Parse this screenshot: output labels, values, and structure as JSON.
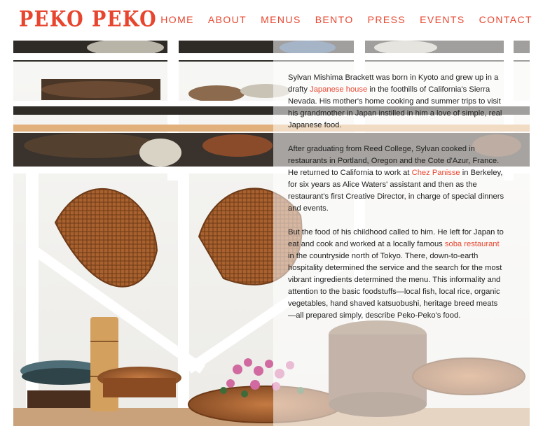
{
  "site": {
    "logo": "PEKO PEKO",
    "nav": [
      "HOME",
      "ABOUT",
      "MENUS",
      "BENTO",
      "PRESS",
      "EVENTS",
      "CONTACT"
    ]
  },
  "colors": {
    "accent": "#e8452e"
  },
  "about": {
    "p1": {
      "a": "Sylvan Mishima Brackett was born in Kyoto and grew up in a drafty ",
      "link": "Japanese house",
      "b": " in the foothills of California's Sierra Nevada. His mother's home cooking and summer trips to visit his grandmother in Japan instilled in him a love of simple, real Japanese food."
    },
    "p2": {
      "a": "After graduating from Reed College, Sylvan cooked in restaurants in Portland, Oregon and the Cote d'Azur, France. He returned to California to work at ",
      "link": "Chez Panisse",
      "b": " in Berkeley, for six years as Alice Waters' assistant and then as the restaurant's first Creative Director, in charge of special dinners and events."
    },
    "p3": {
      "a": "But the food of his childhood called to him. He left for Japan to eat and cook and worked at a locally famous ",
      "link": "soba restaurant",
      "b": " in the countryside north of Tokyo. There, down-to-earth hospitality determined the service and the search for the most vibrant ingredients determined the menu. This informality and attention to the basic foodstuffs—local fish, local rice, organic vegetables, hand shaved katsuobushi, heritage breed meats—all prepared simply, describe Peko-Peko's food."
    }
  }
}
